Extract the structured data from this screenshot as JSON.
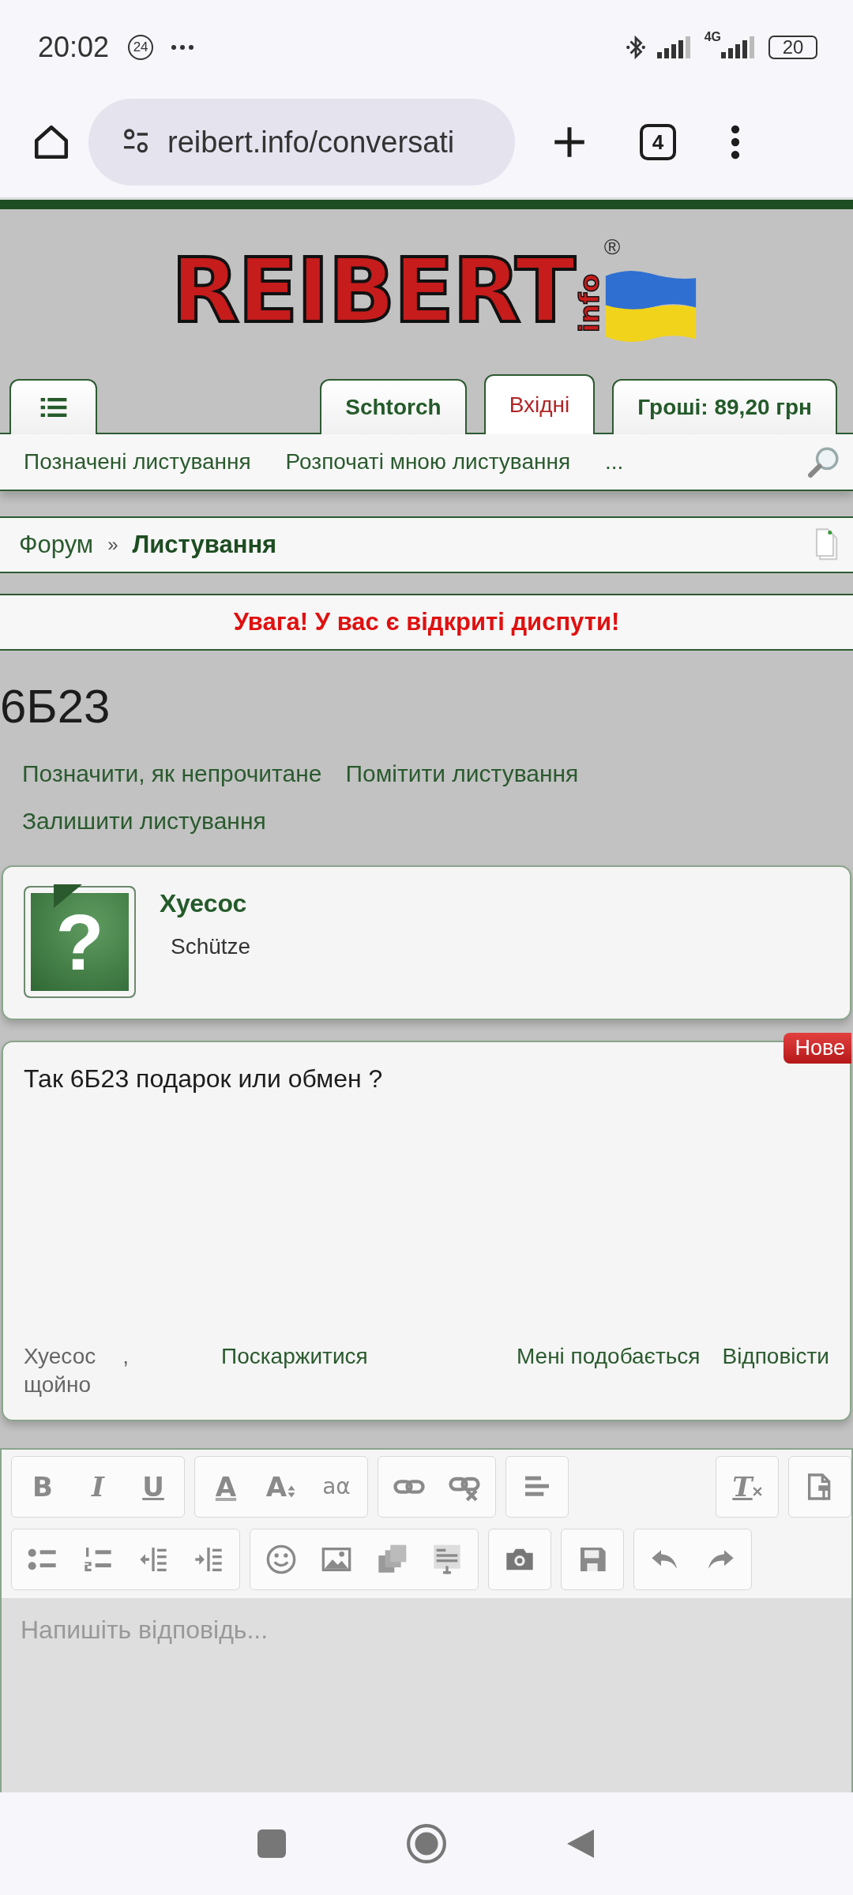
{
  "status_bar": {
    "time": "20:02",
    "notification_count": "24",
    "network": "4G",
    "battery": "20"
  },
  "browser": {
    "url": "reibert.info/conversati",
    "tab_count": "4"
  },
  "logo": {
    "name": "REIBERT",
    "suffix": "info",
    "mark": "®"
  },
  "tabs": [
    {
      "kind": "menu",
      "selected": false
    },
    {
      "kind": "text",
      "label": "Schtorch",
      "selected": false
    },
    {
      "kind": "text",
      "label": "Вхідні",
      "selected": true
    },
    {
      "kind": "text",
      "label": "Гроші: 89,20 грн",
      "selected": false
    }
  ],
  "subnav": [
    "Позначені листування",
    "Розпочаті мною листування",
    "..."
  ],
  "breadcrumb": {
    "items": [
      "Форум",
      "Листування"
    ],
    "separator": "»"
  },
  "alert": "Увага! У вас є відкриті диспути!",
  "conversation": {
    "title": "6Б23",
    "actions": [
      "Позначити, як непрочитане",
      "Помітити листування",
      "Залишити листування"
    ]
  },
  "participant": {
    "avatar_glyph": "?",
    "name": "Хуесос",
    "rank": "Schütze"
  },
  "message": {
    "badge": "Нове",
    "text": "Так 6Б23 подарок или обмен ?",
    "author": "Хуесос",
    "separator": ",",
    "time": "щойно",
    "links": [
      "Поскаржитися",
      "Мені подобається",
      "Відповісти"
    ]
  },
  "editor": {
    "rows": [
      {
        "left": [
          [
            {
              "kind": "bold",
              "label": "B"
            },
            {
              "kind": "italic",
              "label": "I"
            },
            {
              "kind": "underline",
              "label": "U"
            }
          ],
          [
            {
              "kind": "color",
              "label": "A"
            },
            {
              "kind": "size",
              "label": "A"
            },
            {
              "kind": "translit",
              "label": "aα"
            }
          ],
          [
            {
              "kind": "link"
            },
            {
              "kind": "unlink"
            }
          ],
          [
            {
              "kind": "align"
            }
          ]
        ],
        "right": [
          [
            {
              "kind": "clear",
              "label": "T"
            }
          ],
          [
            {
              "kind": "source"
            }
          ]
        ]
      },
      {
        "left": [
          [
            {
              "kind": "bullets"
            },
            {
              "kind": "numbers"
            },
            {
              "kind": "outdent"
            },
            {
              "kind": "indent"
            }
          ],
          [
            {
              "kind": "smiley"
            },
            {
              "kind": "image"
            },
            {
              "kind": "media"
            },
            {
              "kind": "template"
            }
          ],
          [
            {
              "kind": "camera"
            }
          ],
          [
            {
              "kind": "save"
            }
          ],
          [
            {
              "kind": "undo"
            },
            {
              "kind": "redo"
            }
          ]
        ],
        "right": []
      }
    ],
    "placeholder": "Напишіть відповідь..."
  }
}
